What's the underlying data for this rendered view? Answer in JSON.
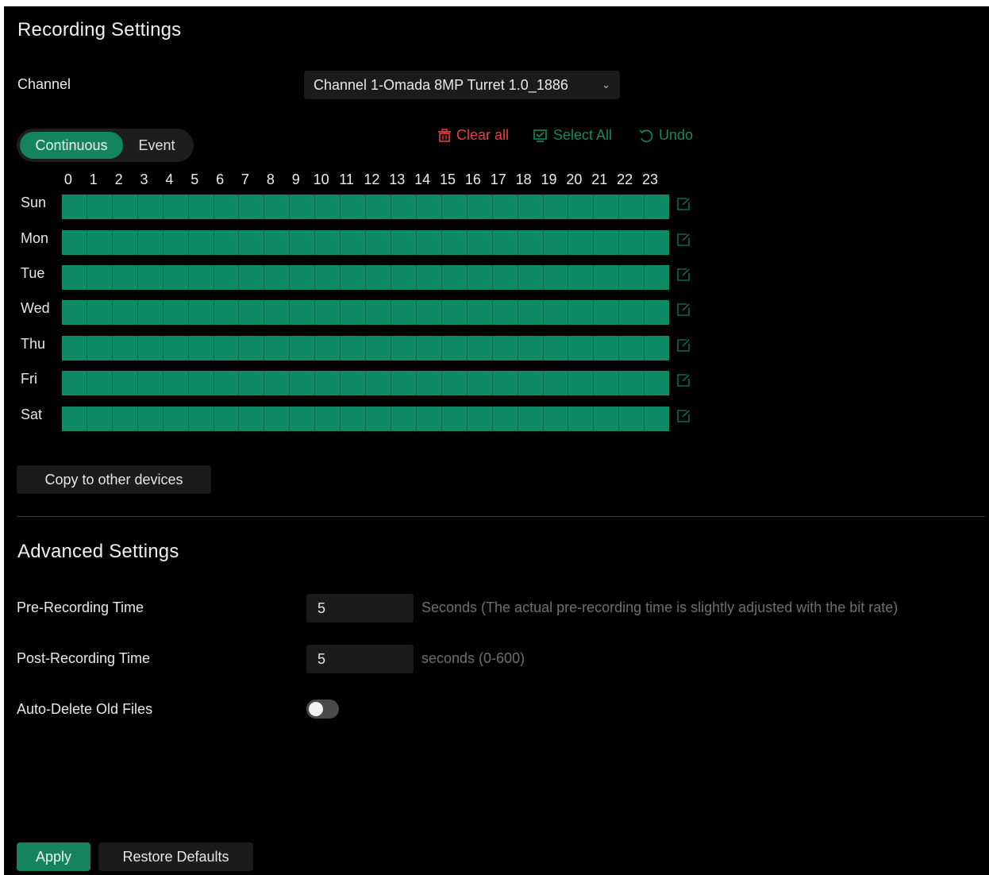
{
  "recording": {
    "title": "Recording Settings",
    "channel_label": "Channel",
    "channel_value": "Channel 1-Omada 8MP Turret 1.0_1886",
    "mode_tabs": [
      "Continuous",
      "Event"
    ],
    "actions": {
      "clear_all": "Clear all",
      "select_all": "Select All",
      "undo": "Undo"
    },
    "hours": [
      "0",
      "1",
      "2",
      "3",
      "4",
      "5",
      "6",
      "7",
      "8",
      "9",
      "10",
      "11",
      "12",
      "13",
      "14",
      "15",
      "16",
      "17",
      "18",
      "19",
      "20",
      "21",
      "22",
      "23"
    ],
    "days": [
      "Sun",
      "Mon",
      "Tue",
      "Wed",
      "Thu",
      "Fri",
      "Sat"
    ],
    "copy_button": "Copy to other devices"
  },
  "advanced": {
    "title": "Advanced Settings",
    "pre_label": "Pre-Recording Time",
    "pre_value": "5",
    "pre_hint": "Seconds (The actual pre-recording time is slightly adjusted with the bit rate)",
    "post_label": "Post-Recording Time",
    "post_value": "5",
    "post_hint": "seconds (0-600)",
    "auto_delete_label": "Auto-Delete Old Files",
    "auto_delete_on": false
  },
  "footer": {
    "apply": "Apply",
    "restore": "Restore Defaults"
  },
  "colors": {
    "accent": "#14845f",
    "schedule_fill": "#0e8b64",
    "danger": "#e8413b",
    "background": "#000000"
  }
}
